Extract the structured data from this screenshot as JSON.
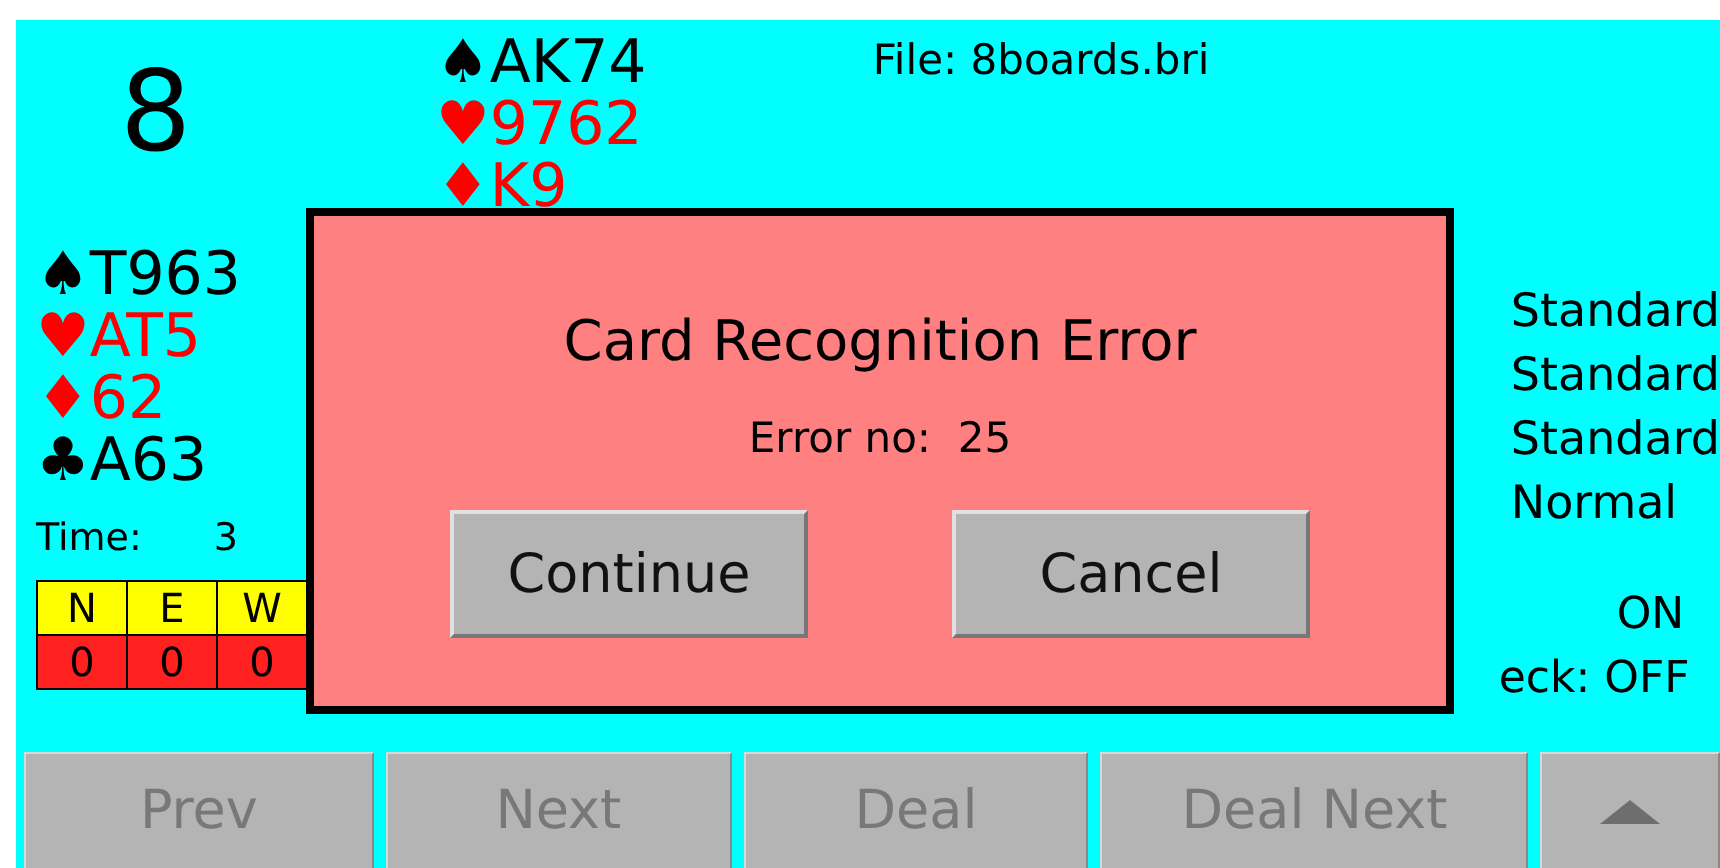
{
  "board_number": "8",
  "north": [
    {
      "suit": "♠",
      "cards": "AK74",
      "color": "#000000"
    },
    {
      "suit": "♥",
      "cards": "9762",
      "color": "#ff0000"
    },
    {
      "suit": "♦",
      "cards": "K9",
      "color": "#ff0000"
    }
  ],
  "west": [
    {
      "suit": "♠",
      "cards": "T963",
      "color": "#000000"
    },
    {
      "suit": "♥",
      "cards": "AT5",
      "color": "#ff0000"
    },
    {
      "suit": "♦",
      "cards": "62",
      "color": "#ff0000"
    },
    {
      "suit": "♣",
      "cards": "A63",
      "color": "#000000"
    }
  ],
  "time": {
    "label": "Time:",
    "value": "3"
  },
  "score_table": {
    "headers": [
      "N",
      "E",
      "W"
    ],
    "values": [
      "0",
      "0",
      "0"
    ]
  },
  "file": "File: 8boards.bri",
  "settings": [
    "Standard",
    "Standard",
    "Standard",
    "Normal"
  ],
  "switches": [
    "ON",
    "eck: OFF"
  ],
  "dialog": {
    "title": "Card Recognition Error",
    "message": "Error no:  25",
    "buttons": [
      "Continue",
      "Cancel"
    ]
  },
  "toolbar": [
    {
      "kind": "text",
      "label": "Prev",
      "disabled": true
    },
    {
      "kind": "text",
      "label": "Next",
      "disabled": true
    },
    {
      "kind": "text",
      "label": "Deal",
      "disabled": true
    },
    {
      "kind": "text",
      "label": "Deal Next",
      "disabled": true
    },
    {
      "kind": "arrow",
      "disabled": true
    }
  ]
}
